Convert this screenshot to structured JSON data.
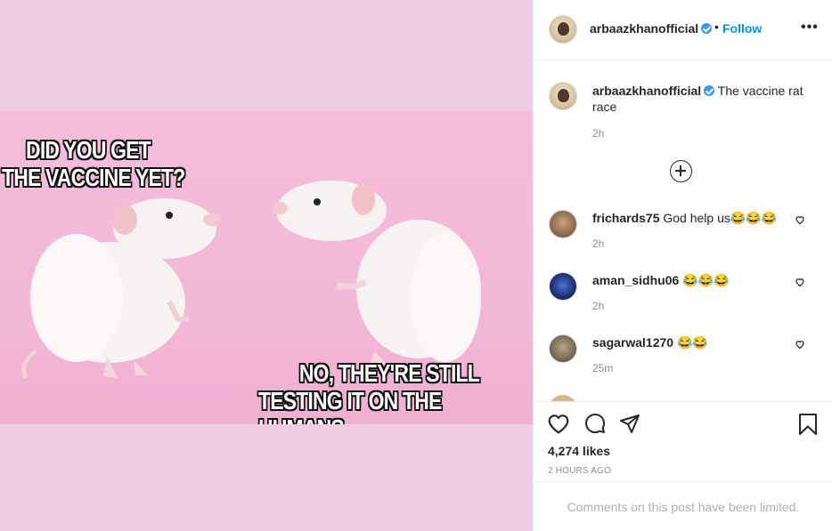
{
  "post": {
    "username": "arbaazkhanofficial",
    "follow_label": "Follow",
    "separator": "•",
    "more_label": "•••",
    "meme": {
      "top_line1": "DID YOU GET",
      "top_line2": "THE VACCINE YET?",
      "bottom_line1": "NO, THEY'RE STILL",
      "bottom_line2": "TESTING IT ON THE HUMANS."
    }
  },
  "caption": {
    "username": "arbaazkhanofficial",
    "text": "The vaccine rat race",
    "time": "2h"
  },
  "comments": [
    {
      "username": "frichards75",
      "text": "God help us😂😂😂",
      "time": "2h"
    },
    {
      "username": "aman_sidhu06",
      "text": "😂😂😂",
      "time": "2h"
    },
    {
      "username": "sagarwal1270",
      "text": "😂😂",
      "time": "25m"
    }
  ],
  "likes": "4,274 likes",
  "post_time": "2 HOURS AGO",
  "comments_limited": "Comments on this post have been limited.",
  "icons": {
    "like": "heart-icon",
    "comment": "comment-bubble-icon",
    "share": "paper-plane-icon",
    "save": "bookmark-icon",
    "load_more": "plus-circle-icon",
    "verified": "verified-badge-icon"
  },
  "colors": {
    "follow": "#0095f6",
    "verified": "#3897f0",
    "meme_background": "#f3b8d8"
  }
}
